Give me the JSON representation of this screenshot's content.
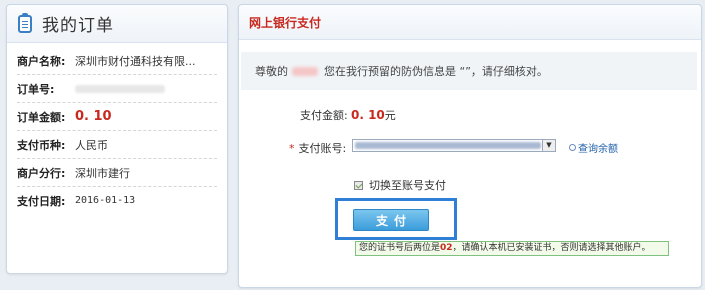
{
  "order": {
    "title": "我的订单",
    "rows": [
      {
        "label": "商户名称:",
        "value": "深圳市财付通科技有限..."
      },
      {
        "label": "订单号:",
        "value": ""
      },
      {
        "label": "订单金额:",
        "value": "0. 10"
      },
      {
        "label": "支付币种:",
        "value": "人民币"
      },
      {
        "label": "商户分行:",
        "value": "深圳市建行"
      },
      {
        "label": "支付日期:",
        "value": "2016-01-13"
      }
    ]
  },
  "payment": {
    "title": "网上银行支付",
    "notice_prefix": "尊敬的",
    "notice_suffix": "您在我行预留的防伪信息是 “”，请仔细核对。",
    "amount_label": "支付金额:",
    "amount_value": "0. 10",
    "amount_unit": "元",
    "account_required_mark": "*",
    "account_label": "支付账号:",
    "balance_link": "查询余额",
    "switch_label": "切换至账号支付",
    "pay_button": "支付",
    "cert_note_prefix": "您的证书号后两位是",
    "cert_note_code": "02",
    "cert_note_suffix": "，请确认本机已安装证书，否则请选择其他账户。"
  },
  "colors": {
    "accent_red": "#c8281e",
    "button_blue": "#3a9ddb",
    "highlight_frame": "#2f7fd6",
    "note_green_border": "#7fc27f"
  }
}
